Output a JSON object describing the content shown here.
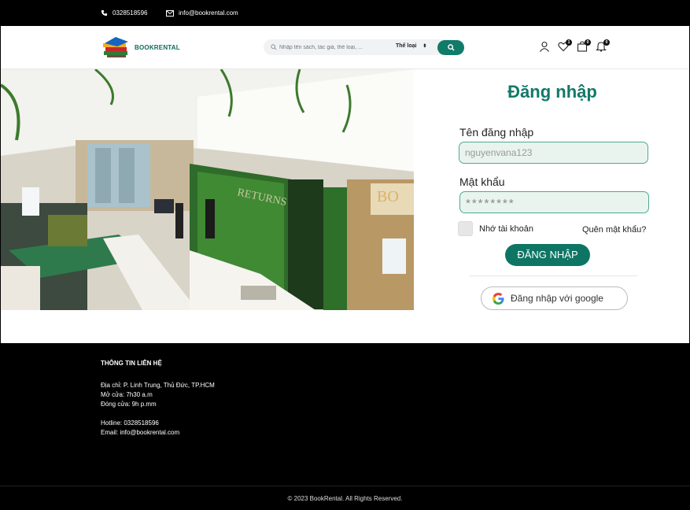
{
  "topbar": {
    "phone": "0328518596",
    "email": "info@bookrental.com"
  },
  "header": {
    "logo_text": "BOOKRENTAL",
    "search_placeholder": "Nhập tên sách, tác giả, thể loại, ...",
    "category_label": "Thể loại",
    "wishlist_count": "1",
    "cart_count": "0",
    "notify_count": "0"
  },
  "login": {
    "title": "Đăng nhập",
    "username_label": "Tên đăng nhập",
    "username_value": "nguyenvana123",
    "password_label": "Mật khẩu",
    "password_value": "********",
    "remember_label": "Nhớ tài khoản",
    "forgot_label": "Quên mật khẩu?",
    "submit_label": "ĐĂNG NHẬP",
    "google_label": "Đăng nhập với google"
  },
  "footer": {
    "heading": "THÔNG TIN LIÊN HỆ",
    "address": "Địa chỉ: P. Linh Trung, Thủ Đức, TP.HCM",
    "open": "Mở cửa: 7h30 a.m",
    "close": "Đóng cửa: 9h p.mm",
    "hotline": "Hotline: 0328518596",
    "email": "Email: info@bookrental.com",
    "copyright": "© 2023 BookRental. All Rights Reserved."
  },
  "colors": {
    "brand": "#0f7b68",
    "footer": "#000000"
  }
}
